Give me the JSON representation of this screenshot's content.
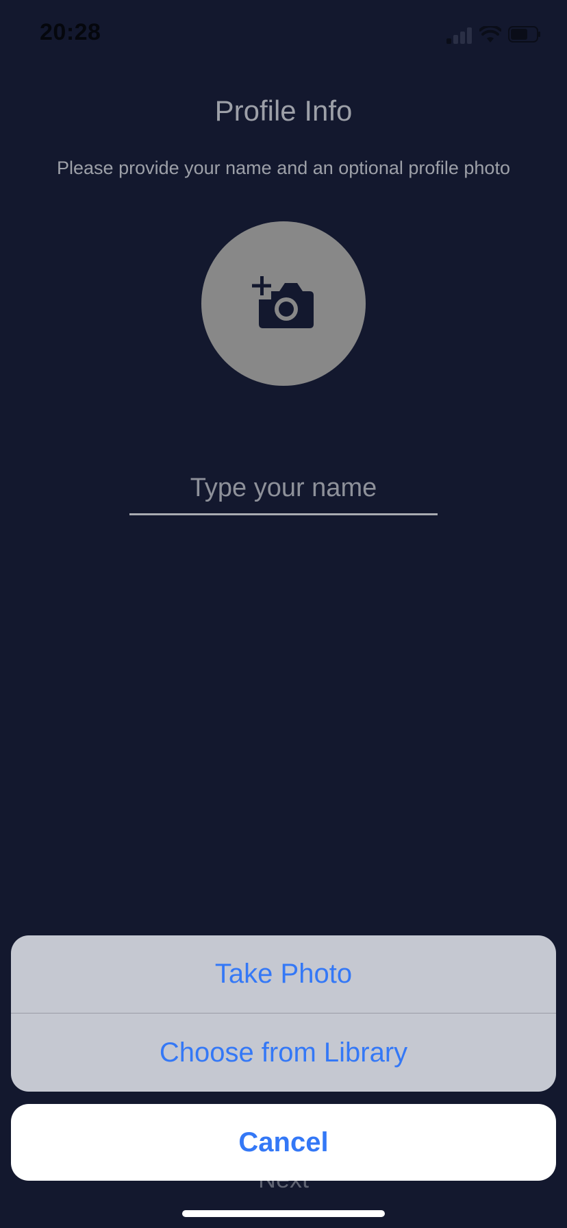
{
  "status_bar": {
    "time": "20:28"
  },
  "header": {
    "title": "Profile Info",
    "subtitle": "Please provide your name and an optional profile photo"
  },
  "avatar": {
    "icon": "add-photo-camera-icon"
  },
  "name_field": {
    "placeholder": "Type your name",
    "value": ""
  },
  "footer": {
    "next_label": "Next"
  },
  "action_sheet": {
    "options": [
      {
        "label": "Take Photo"
      },
      {
        "label": "Choose from Library"
      }
    ],
    "cancel_label": "Cancel"
  },
  "colors": {
    "background": "#13182e",
    "accent": "#3478f6",
    "sheet": "#c5c8d1",
    "avatar": "#888888"
  }
}
